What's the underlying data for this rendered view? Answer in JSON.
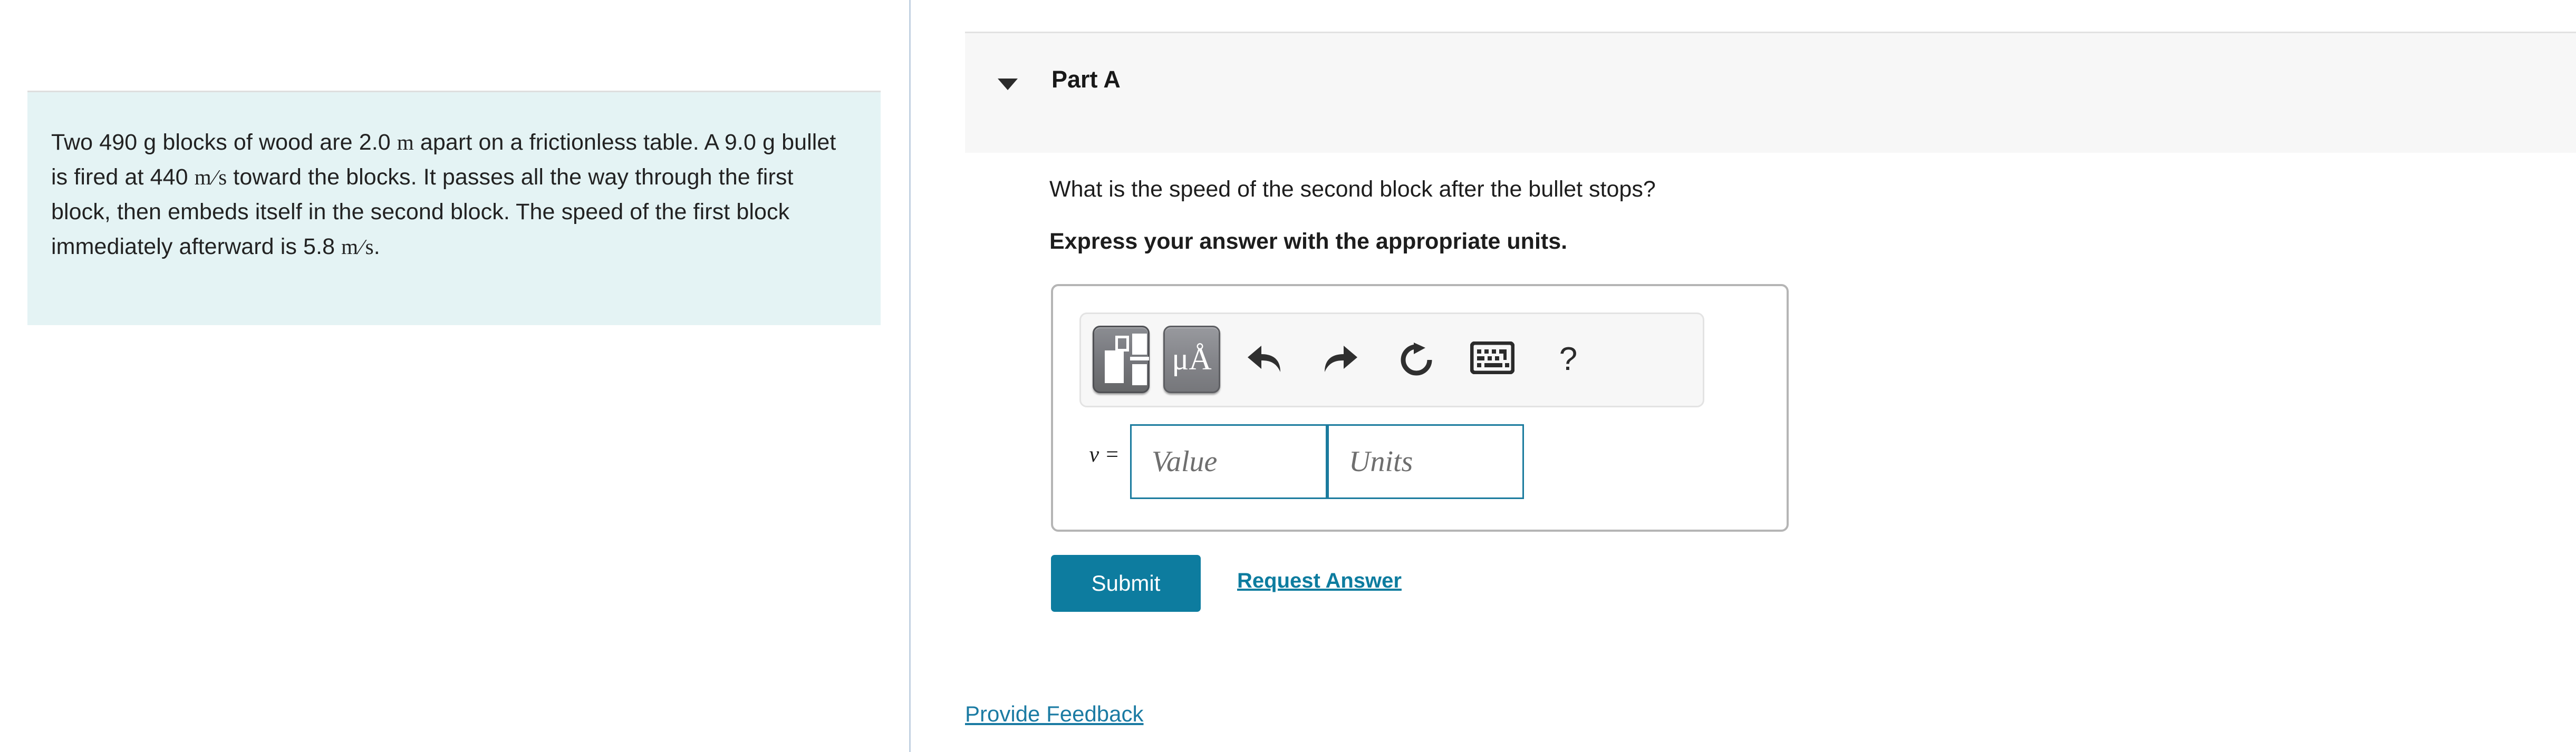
{
  "problem": {
    "segments": [
      {
        "t": "Two 490 g blocks of wood are 2.0 ",
        "k": "plain"
      },
      {
        "t": "m",
        "k": "math"
      },
      {
        "t": " apart on a frictionless table. A 9.0 g bullet is fired at 440 ",
        "k": "plain"
      },
      {
        "t": "m/s",
        "k": "frac"
      },
      {
        "t": " toward the blocks. It passes all the way through the first block, then embeds itself in the second block. The speed of the first block immediately afterward is 5.8 ",
        "k": "plain"
      },
      {
        "t": "m/s",
        "k": "frac"
      },
      {
        "t": ".",
        "k": "plain"
      }
    ],
    "full_text": "Two 490 g blocks of wood are 2.0 m apart on a frictionless table. A 9.0 g bullet is fired at 440 m/s toward the blocks. It passes all the way through the first block, then embeds itself in the second block. The speed of the first block immediately afterward is 5.8 m/s."
  },
  "part": {
    "title": "Part A",
    "toggle_icon": "chevron-down-icon",
    "question": "What is the speed of the second block after the bullet stops?",
    "instruction": "Express your answer with the appropriate units."
  },
  "answer": {
    "variable_label": "v =",
    "value_placeholder": "Value",
    "units_placeholder": "Units",
    "value": "",
    "units": "",
    "toolbar": [
      {
        "name": "math-template-icon",
        "label": "",
        "active": true
      },
      {
        "name": "greek-symbols-icon",
        "label": "μÅ",
        "active": true
      },
      {
        "name": "undo-icon",
        "label": ""
      },
      {
        "name": "redo-icon",
        "label": ""
      },
      {
        "name": "reset-icon",
        "label": ""
      },
      {
        "name": "keyboard-icon",
        "label": ""
      },
      {
        "name": "help-icon",
        "label": "?"
      }
    ]
  },
  "actions": {
    "submit_label": "Submit",
    "request_answer_label": "Request Answer",
    "provide_feedback_label": "Provide Feedback"
  },
  "colors": {
    "accent": "#0d7c9f",
    "link": "#1b7ba3",
    "problem_background": "#e4f3f4",
    "header_background": "#f7f7f7",
    "input_border": "#1b7b9e",
    "divider": "#c3d2e2"
  }
}
